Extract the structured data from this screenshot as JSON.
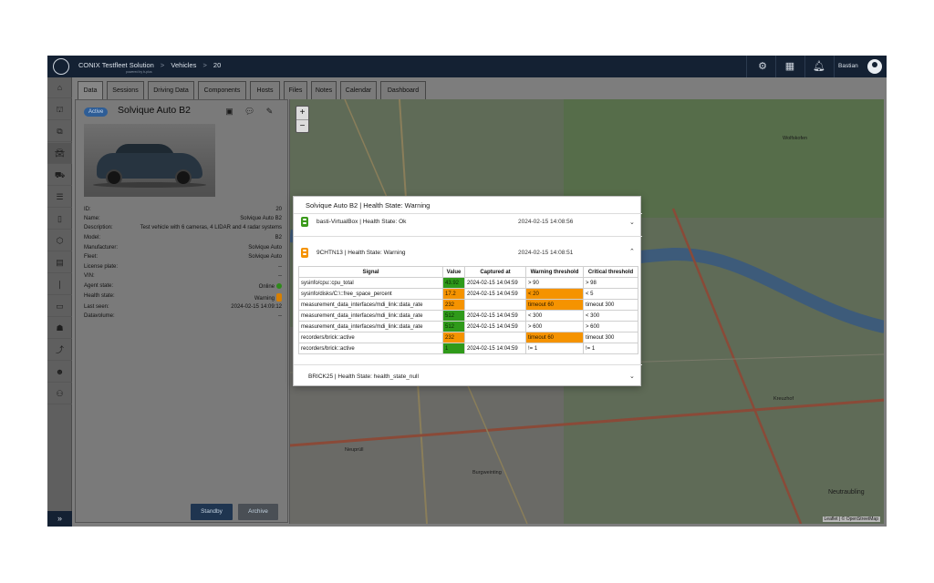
{
  "header": {
    "brand": "CONIX Testfleet Solution",
    "powered": "powered by b-plus",
    "breadcrumb": [
      "Vehicles",
      "20"
    ],
    "separator": ">",
    "user": "Bastian"
  },
  "sidebar": {
    "items": [
      "home",
      "dashboard",
      "devices",
      "vehicles",
      "fleets",
      "list",
      "hardware",
      "box",
      "storage",
      "sensor",
      "car",
      "drivers",
      "routes",
      "users",
      "groups"
    ],
    "expand_icon": "»"
  },
  "tabs": [
    {
      "label": "Data",
      "active": true
    },
    {
      "label": "Sessions"
    },
    {
      "label": "Driving Data"
    },
    {
      "label": "Components"
    },
    {
      "label": "Hosts"
    },
    {
      "label": "Files"
    },
    {
      "label": "Notes"
    },
    {
      "label": "Calendar"
    },
    {
      "label": "Dashboard"
    }
  ],
  "vehicle": {
    "status_badge": "Active",
    "title": "Solvique Auto B2",
    "properties": [
      {
        "key": "ID:",
        "value": "20"
      },
      {
        "key": "Name:",
        "value": "Solvique Auto B2"
      },
      {
        "key": "Description:",
        "value": "Test vehicle with 6 cameras, 4 LIDAR and 4 radar systems"
      },
      {
        "key": "Model:",
        "value": "B2"
      },
      {
        "key": "Manufacturer:",
        "value": "Solvique Auto"
      },
      {
        "key": "Fleet:",
        "value": "Solvique Auto"
      },
      {
        "key": "License plate:",
        "value": "--"
      },
      {
        "key": "VIN:",
        "value": "--"
      },
      {
        "key": "Agent state:",
        "value": "Online"
      },
      {
        "key": "Health state:",
        "value": "Warning"
      },
      {
        "key": "Last seen:",
        "value": "2024-02-15 14:09:12"
      },
      {
        "key": "Datavolume:",
        "value": "--"
      }
    ],
    "buttons": {
      "standby": "Standby",
      "archive": "Archive"
    }
  },
  "map": {
    "zoom_in": "+",
    "zoom_out": "−",
    "attribution": "Leaflet | © OpenStreetMap",
    "labels": [
      "Neutraubling",
      "Kreuzhof",
      "Burgweinting",
      "Neuprüll",
      "Wolfskofen"
    ]
  },
  "modal": {
    "title": "Solvique Auto B2 | Health State: Warning",
    "hosts": [
      {
        "label": "basti-VirtualBox | Health State: Ok",
        "time": "2024-02-15 14:08:56",
        "state": "ok",
        "expanded": false
      },
      {
        "label": "9CHTN13 | Health State: Warning",
        "time": "2024-02-15 14:08:51",
        "state": "warning",
        "expanded": true
      },
      {
        "label": "BRICK25 | Health State: health_state_null",
        "time": "",
        "state": "null",
        "expanded": false
      }
    ],
    "table": {
      "headers": [
        "Signal",
        "Value",
        "Captured at",
        "Warning threshold",
        "Critical threshold"
      ],
      "rows": [
        {
          "signal": "sysinfo/cpu::cpu_total",
          "value": "43.92",
          "captured": "2024-02-15 14:04:59",
          "warning": "> 90",
          "critical": "> 98",
          "vstate": "green",
          "wstate": ""
        },
        {
          "signal": "sysinfo/disks/C:\\::free_space_percent",
          "value": "17.2",
          "captured": "2024-02-15 14:04:59",
          "warning": "< 20",
          "critical": "< 5",
          "vstate": "orange",
          "wstate": "orange"
        },
        {
          "signal": "measurement_data_interfaces/mdi_link::data_rate",
          "value": "232",
          "captured": "",
          "warning": "timeout 60",
          "critical": "timeout 300",
          "vstate": "orange",
          "wstate": "orange"
        },
        {
          "signal": "measurement_data_interfaces/mdi_link::data_rate",
          "value": "512",
          "captured": "2024-02-15 14:04:59",
          "warning": "< 300",
          "critical": "< 300",
          "vstate": "green",
          "wstate": ""
        },
        {
          "signal": "measurement_data_interfaces/mdi_link::data_rate",
          "value": "512",
          "captured": "2024-02-15 14:04:59",
          "warning": "> 600",
          "critical": "> 600",
          "vstate": "green",
          "wstate": ""
        },
        {
          "signal": "recorders/brick::active",
          "value": "232",
          "captured": "",
          "warning": "timeout 60",
          "critical": "timeout 300",
          "vstate": "orange",
          "wstate": "orange"
        },
        {
          "signal": "recorders/brick::active",
          "value": "1",
          "captured": "2024-02-15 14:04:59",
          "warning": "!= 1",
          "critical": "!= 1",
          "vstate": "green",
          "wstate": ""
        }
      ]
    }
  },
  "colors": {
    "topbar": "#142133",
    "accent": "#2e5d96",
    "ok": "#2f9a1a",
    "warning": "#f59300"
  }
}
